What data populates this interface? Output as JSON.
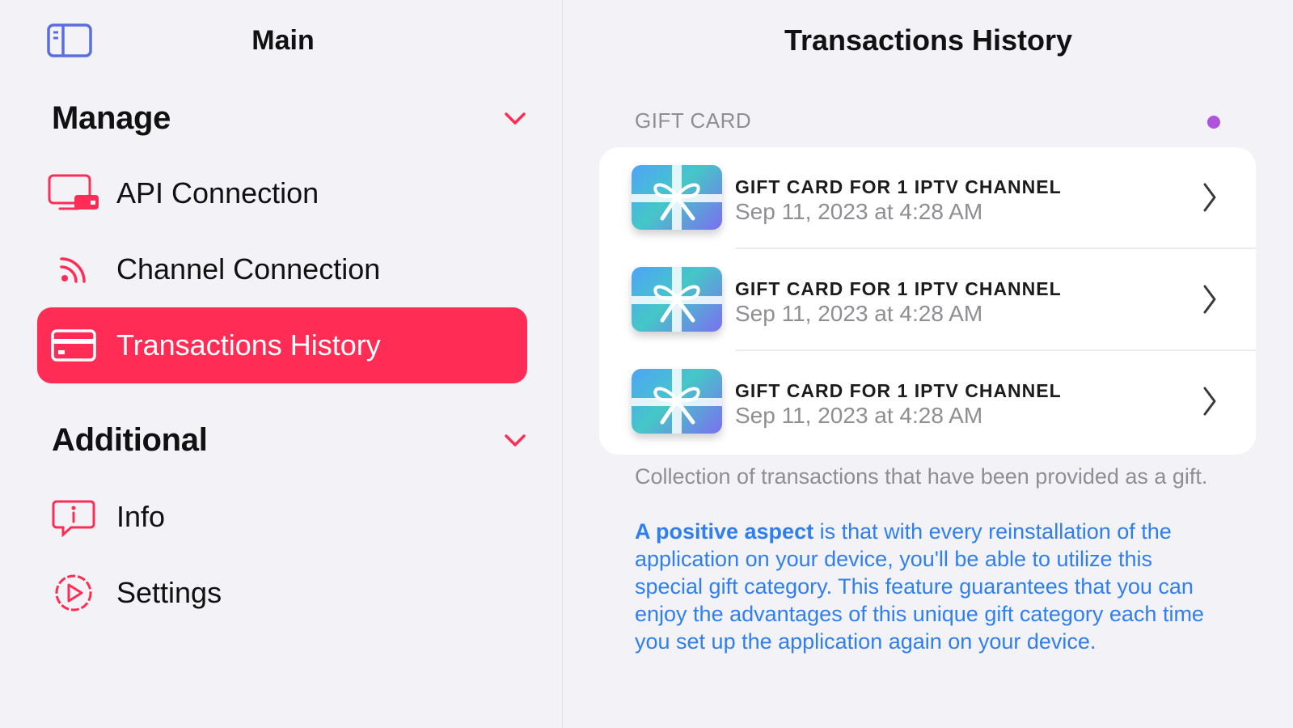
{
  "colors": {
    "accent": "#ff2d55",
    "background": "#f2f2f7",
    "card": "#ffffff",
    "secondary_text": "#8e8e93",
    "link_blue": "#2f7ff0",
    "sidebar_icon": "#5a6ee0",
    "status_dot": "#af52de"
  },
  "sidebar": {
    "toggle_icon": "sidebar-toggle-icon",
    "title": "Main",
    "sections": [
      {
        "label": "Manage",
        "items": [
          {
            "label": "API Connection",
            "icon": "monitor-connection-icon",
            "active": false
          },
          {
            "label": "Channel Connection",
            "icon": "rss-feed-icon",
            "active": false
          },
          {
            "label": "Transactions History",
            "icon": "credit-card-icon",
            "active": true
          }
        ]
      },
      {
        "label": "Additional",
        "items": [
          {
            "label": "Info",
            "icon": "info-bubble-icon",
            "active": false
          },
          {
            "label": "Settings",
            "icon": "settings-play-icon",
            "active": false
          }
        ]
      }
    ]
  },
  "main": {
    "title": "Transactions History",
    "group_header": "GIFT CARD",
    "transactions": [
      {
        "title": "GIFT CARD FOR 1 IPTV CHANNEL",
        "date": "Sep 11, 2023 at 4:28 AM",
        "icon": "gift-card-icon"
      },
      {
        "title": "GIFT CARD FOR 1 IPTV CHANNEL",
        "date": "Sep 11, 2023 at 4:28 AM",
        "icon": "gift-card-icon"
      },
      {
        "title": "GIFT CARD FOR 1 IPTV CHANNEL",
        "date": "Sep 11, 2023 at 4:28 AM",
        "icon": "gift-card-icon"
      }
    ],
    "footer_note": "Collection of transactions that have been provided as a gift.",
    "footer_info_lead": "A positive aspect",
    "footer_info_rest": " is that with every reinstallation of the application on your device, you'll be able to utilize this special gift category. This feature guarantees that you can enjoy the advantages of this unique gift category each time you set up the application again on your device."
  }
}
